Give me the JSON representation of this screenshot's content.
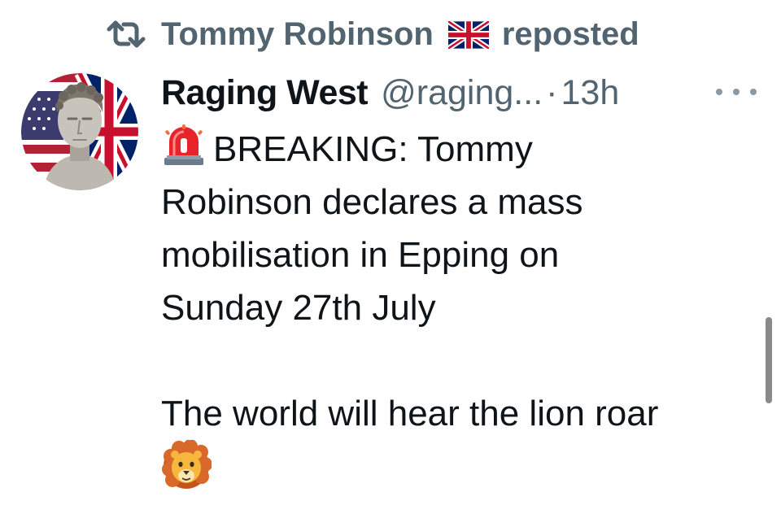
{
  "repost": {
    "name": "Tommy Robinson",
    "suffix": "reposted",
    "icon": "repost-icon",
    "flag": "uk-flag-emoji"
  },
  "tweet": {
    "display_name": "Raging West",
    "handle": "@raging...",
    "separator": "·",
    "time": "13h",
    "more_icon": "more-horizontal-icon",
    "lines": [
      "BREAKING: Tommy",
      "Robinson declares a mass",
      "mobilisation in Epping on",
      "Sunday 27th July"
    ],
    "second_paragraph": "The world will hear the lion roar",
    "leading_emoji": "siren-emoji",
    "trailing_emoji": "lion-emoji"
  },
  "colors": {
    "text_primary": "#0f1419",
    "text_secondary": "#536471",
    "scrollbar": "#8a8a8a"
  }
}
